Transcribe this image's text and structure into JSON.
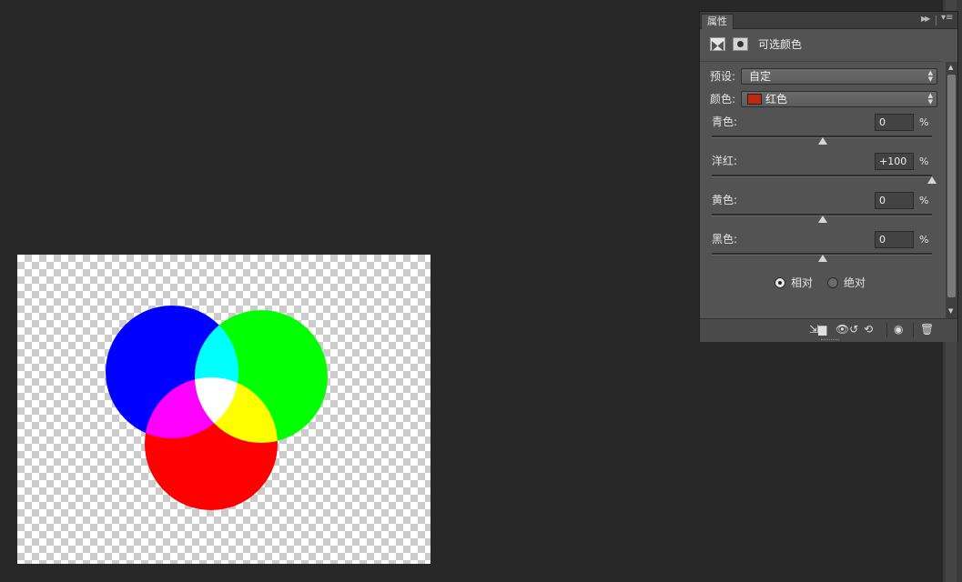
{
  "panel": {
    "tab": "属性",
    "title": "可选颜色",
    "preset": {
      "label": "预设:",
      "value": "自定"
    },
    "colors": {
      "label": "颜色:",
      "value": "红色",
      "swatch": "#c0280f"
    },
    "sliders": [
      {
        "label": "青色:",
        "value": "0",
        "level": 0
      },
      {
        "label": "洋红:",
        "value": "+100",
        "level": 100
      },
      {
        "label": "黄色:",
        "value": "0",
        "level": 0
      },
      {
        "label": "黑色:",
        "value": "0",
        "level": 0
      }
    ],
    "percent": "%",
    "method": {
      "relative": "相对",
      "absolute": "绝对",
      "selected": "relative"
    }
  },
  "canvas": {
    "circles": [
      {
        "name": "blue",
        "color": "#0000ff"
      },
      {
        "name": "green",
        "color": "#00ff00"
      },
      {
        "name": "red",
        "color": "#ff0000"
      }
    ]
  }
}
